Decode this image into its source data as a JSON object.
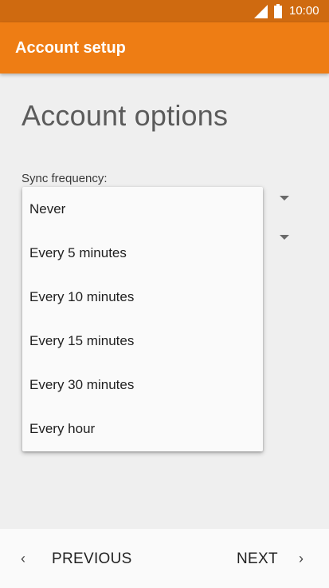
{
  "status_bar": {
    "time": "10:00",
    "icons": [
      "signal-icon",
      "battery-icon"
    ],
    "color": "#cf6a10"
  },
  "app_bar": {
    "title": "Account setup",
    "color": "#ee7d14"
  },
  "main": {
    "heading": "Account options",
    "sync_label": "Sync frequency:"
  },
  "dropdown": {
    "options": [
      "Never",
      "Every 5 minutes",
      "Every 10 minutes",
      "Every 15 minutes",
      "Every 30 minutes",
      "Every hour"
    ]
  },
  "navigation": {
    "previous_label": "PREVIOUS",
    "next_label": "NEXT",
    "previous_icon": "chevron-left-icon",
    "next_icon": "chevron-right-icon",
    "chevron_left": "‹",
    "chevron_right": "›"
  }
}
